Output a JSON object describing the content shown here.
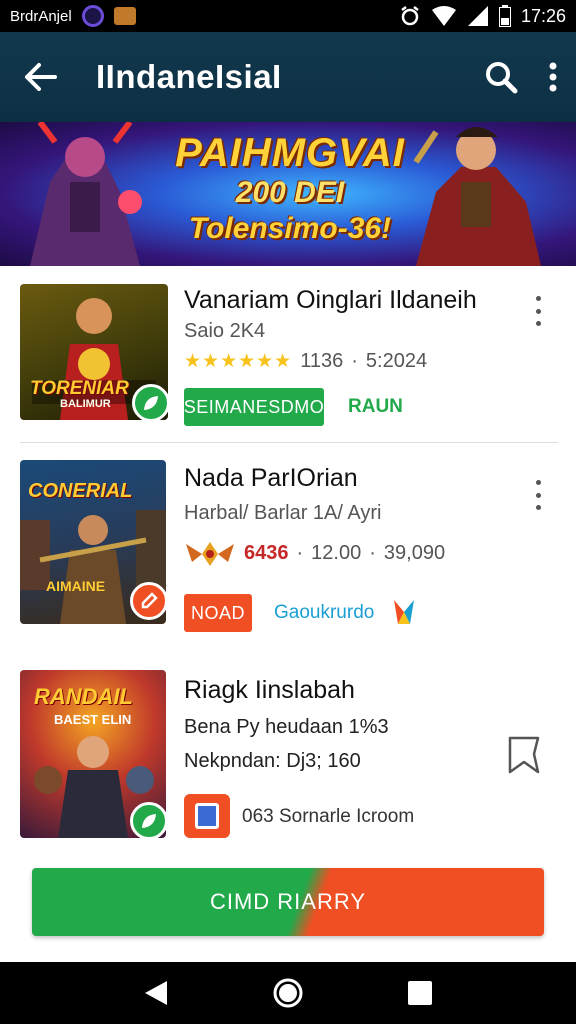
{
  "status_bar": {
    "carrier": "BrdrAnjel",
    "time": "17:26"
  },
  "toolbar": {
    "title": "IIndaneIsiaI"
  },
  "banner": {
    "line1": "PAIHMGVAI",
    "line2": "200 DEI",
    "line3": "Tolensimo-36!"
  },
  "apps": [
    {
      "title": "Vanariam Oinglari Ildaneih",
      "subtitle": "Saio 2K4",
      "rating_count": "1136",
      "stat": "5:2024",
      "primary_action": "SEIMANESDMO",
      "secondary_action": "RAUN",
      "thumb_caption_1": "TORENIAR",
      "thumb_caption_2": "BALIMUR"
    },
    {
      "title": "Nada ParIOrian",
      "subtitle": "Harbal/ Barlar 1A/ Ayri",
      "price": "6436",
      "stat_a": "12.00",
      "stat_b": "39,090",
      "primary_action": "NOAD",
      "secondary_action": "Gaoukrurdo",
      "thumb_caption_1": "CONERIAL",
      "thumb_caption_2": "AIMAINE"
    },
    {
      "title": "Riagk Iinslabah",
      "subtitle": "Bena Py heudaan  1%3",
      "meta": "Nekpndan: Dj3; 160",
      "footer_text": "063 Sornarle Icroom",
      "thumb_caption_1": "RANDAIL",
      "thumb_caption_2": "BAEST ELIN"
    }
  ],
  "cta": {
    "label": "CIMD RIARRY"
  },
  "colors": {
    "green": "#22a94a",
    "orange": "#f04e23",
    "toolbar": "#12384d",
    "star": "#f7c21b"
  }
}
